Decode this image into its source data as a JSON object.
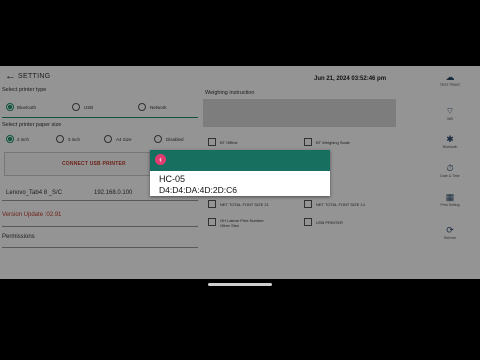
{
  "header": {
    "back_icon": "←",
    "title": "SETTING",
    "datetime": "Jun 21, 2024 03:52:46 pm"
  },
  "printer_type": {
    "label": "Select printer type",
    "options": [
      "Bluetooth",
      "USB",
      "Network"
    ],
    "selected": "Bluetooth"
  },
  "paper_size": {
    "label": "Select printer paper size",
    "options": [
      "2 inch",
      "3 inch",
      "A4 Size",
      "Disabled"
    ],
    "selected": "2 inch"
  },
  "usb": {
    "button_label": "CONNECT USB PRINTER"
  },
  "fields": {
    "printer_name": "Lenovo_Tab4 8 _S/C",
    "ip": "192.168.0.100",
    "update_text": "Version Update :02.91",
    "permissions": "Permissions"
  },
  "weighing": {
    "label": "Weighing instruction"
  },
  "checkboxes": [
    {
      "label": "BT Offline",
      "checked": false
    },
    {
      "label": "BT Weighing Scale",
      "checked": false
    },
    {
      "label": "NET TOTAL FONT SIZE 21",
      "checked": false
    },
    {
      "label": "NET TOTAL FONT SIZE 14",
      "checked": false
    },
    {
      "label": "OH Lakme Print Number Other Size",
      "checked": false
    },
    {
      "label": "USB PRINTER",
      "checked": false
    }
  ],
  "sidebar": [
    {
      "icon": "☁",
      "icon_name": "cloud-icon",
      "label": "TEST PRINT"
    },
    {
      "icon": "⌔",
      "icon_name": "wifi-icon",
      "label": "Wifi"
    },
    {
      "icon": "✱",
      "icon_name": "bluetooth-icon",
      "label": "Bluetooth"
    },
    {
      "icon": "⏱",
      "icon_name": "clock-icon",
      "label": "Date & Time"
    },
    {
      "icon": "▦",
      "icon_name": "keyboard-icon",
      "label": "Print Setting"
    },
    {
      "icon": "⟳",
      "icon_name": "refresh-icon",
      "label": "Refresh"
    }
  ],
  "dialog": {
    "close_icon": "‹",
    "device_name": "HC-05",
    "device_address": "D4:D4:DA:4D:2D:C6"
  },
  "colors": {
    "accent": "#17705f",
    "error": "#c0392b",
    "dialog_close": "#e23b72"
  }
}
